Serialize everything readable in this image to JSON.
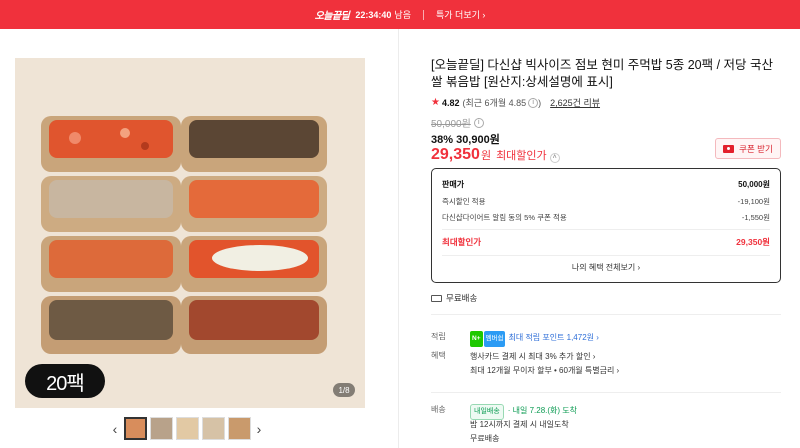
{
  "banner": {
    "logo": "오늘끝딜",
    "timer": "22:34:40",
    "timer_suffix": "남음",
    "more_label": "특가 더보기",
    "more_chevron": "›",
    "bg_color": "#f0313c"
  },
  "gallery": {
    "badge": "20팩",
    "counter": "1/8",
    "prev_icon": "‹",
    "next_icon": "›",
    "thumbnail_count": 5
  },
  "product": {
    "title": "[오늘끝딜] 다신샵 빅사이즈 점보 현미 주먹밥 5종 20팩 / 저당 국산쌀 볶음밥 [원산지:상세설명에 표시]",
    "rating": "4.82",
    "rating_detail": "(최근 6개월 4.85",
    "rating_detail_end": ")",
    "reviews": "2,625건 리뷰",
    "original_price": "50,000원",
    "discount_line": "38% 30,900원",
    "final_price": "29,350",
    "final_price_unit": "원",
    "final_price_label": "최대할인가",
    "coupon_button": "쿠폰 받기"
  },
  "price_box": {
    "rows": [
      {
        "label": "판매가",
        "value": "50,000원"
      },
      {
        "label": "즉시할인 적용",
        "value": "-19,100원"
      },
      {
        "label": "다신샵다이어트 알림 동의 5% 쿠폰 적용",
        "value": "-1,550원"
      }
    ],
    "max_label": "최대할인가",
    "max_value": "29,350원",
    "more_label": "나의 혜택 전체보기 ›"
  },
  "shipping_free": "무료배송",
  "info": {
    "points_label": "적립",
    "points_badge_n": "N+",
    "points_badge_pay": "멤버쉽",
    "points_text": "최대 적립 포인트 1,472원 ›",
    "benefit_label": "혜택",
    "benefit_line1": "행사카드 결제 시 최대 3% 추가 할인 ›",
    "benefit_line2": "최대 12개월 무이자 할부 • 60개월 특별금리 ›",
    "delivery_label": "배송",
    "delivery_badge": "내일배송",
    "delivery_date": "· 내일 7.28.(화) 도착",
    "delivery_line2": "밤 12시까지 결제 시 내일도착",
    "delivery_line3": "무료배송"
  }
}
